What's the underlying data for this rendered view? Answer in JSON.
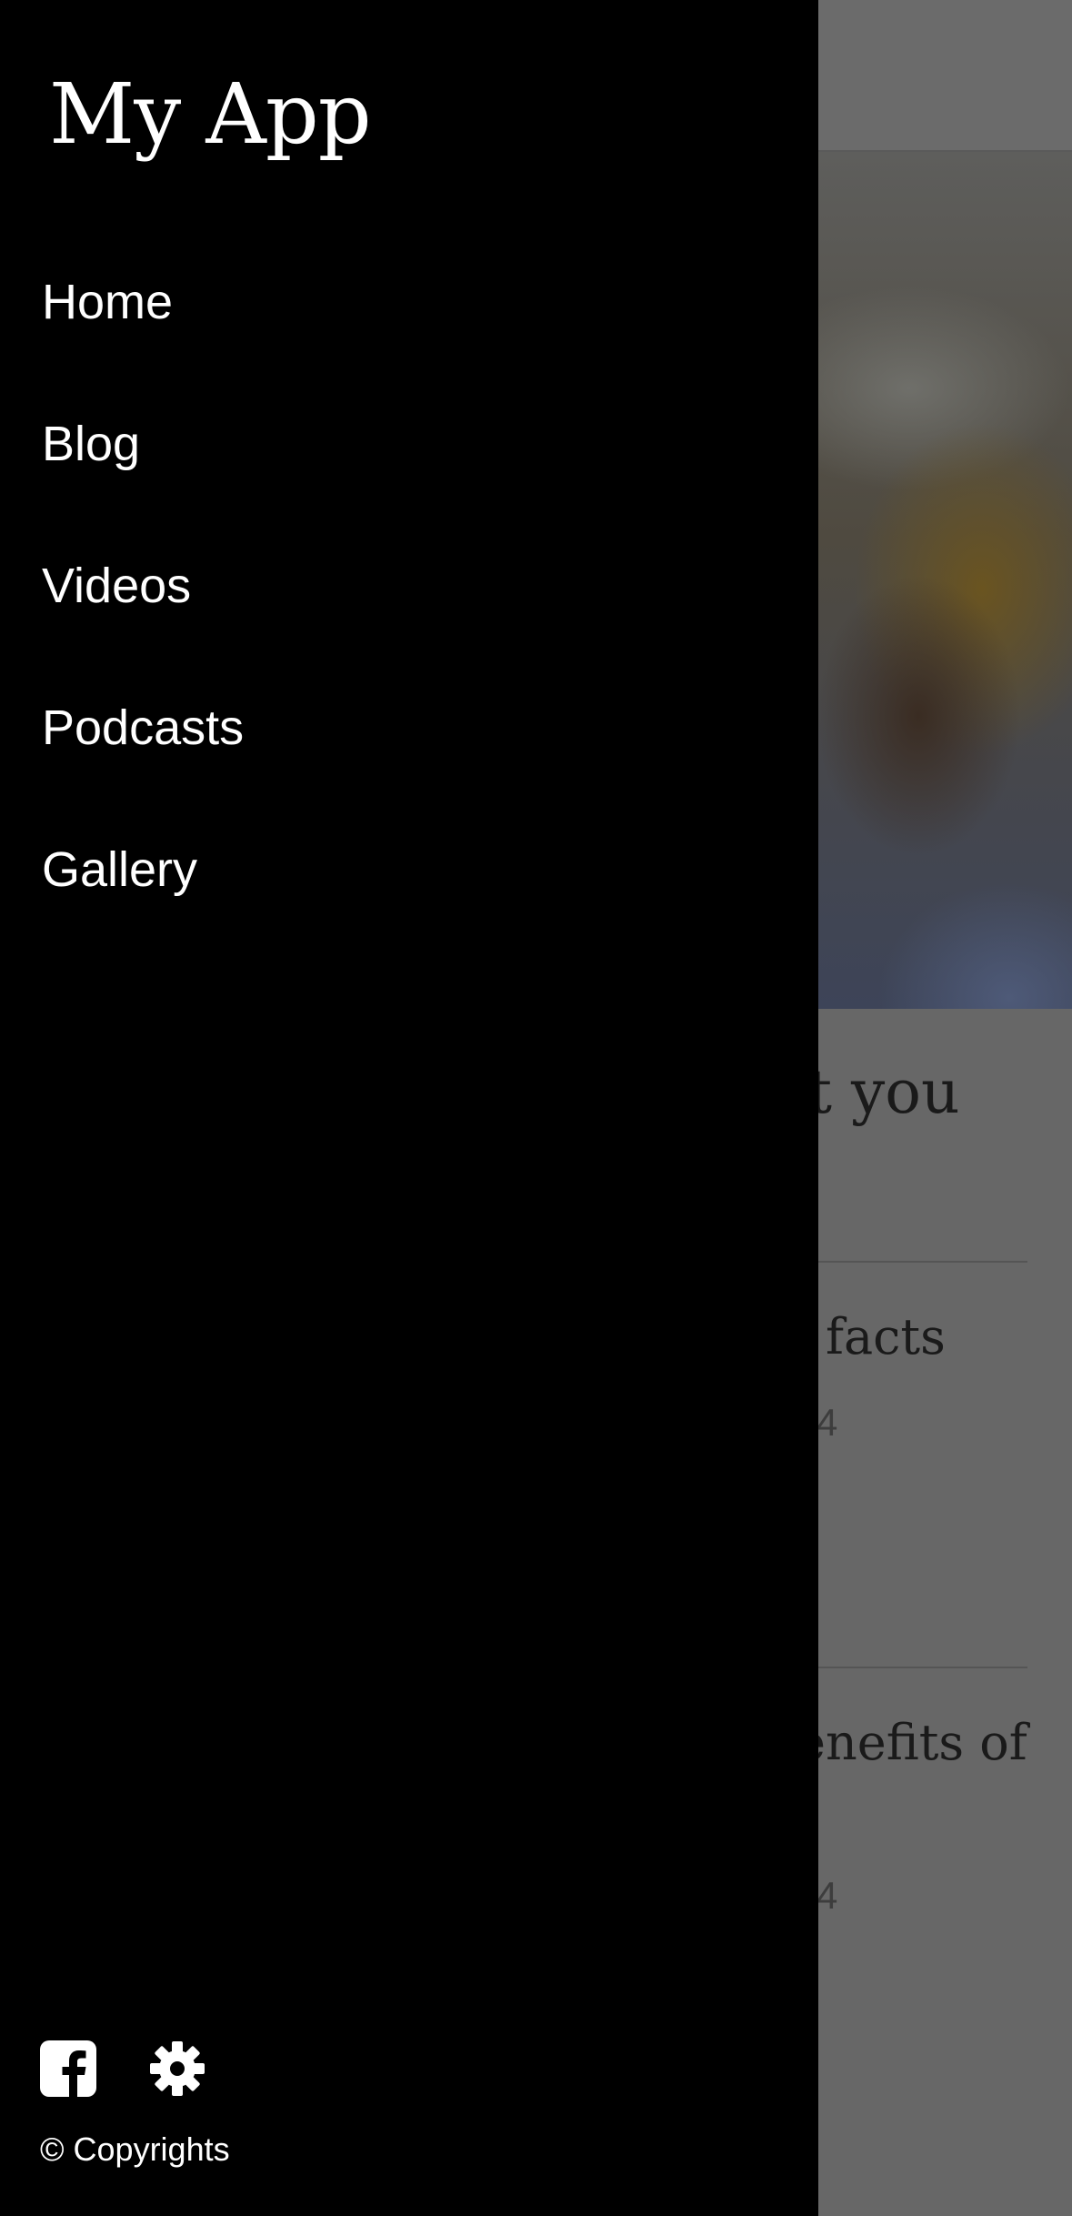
{
  "app": {
    "title": "My App"
  },
  "drawer": {
    "nav_items": [
      {
        "label": "Home",
        "icon": "home"
      },
      {
        "label": "Blog",
        "icon": "blog"
      },
      {
        "label": "Videos",
        "icon": "videos"
      },
      {
        "label": "Podcasts",
        "icon": "podcasts"
      },
      {
        "label": "Gallery",
        "icon": "gallery"
      }
    ],
    "footer": {
      "icons": [
        "facebook-icon",
        "gear-icon"
      ],
      "copyright": "© Copyrights"
    },
    "background_color": "#000000",
    "text_color": "#ffffff"
  },
  "background_content": {
    "section_heading_partial": "ut you",
    "articles": [
      {
        "title_partial": "facts",
        "date_partial": "4"
      },
      {
        "title_partial": "enefits of",
        "date_partial": "4"
      }
    ],
    "overlay_color": "#666666"
  }
}
